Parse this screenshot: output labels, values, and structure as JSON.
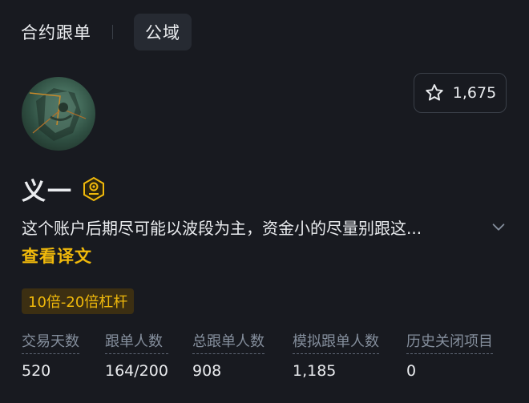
{
  "nav": {
    "title": "合约跟单",
    "pill": "公域"
  },
  "profile": {
    "name": "义一",
    "follow_count": "1,675",
    "bio": "这个账户后期尽可能以波段为主，资金小的尽量别跟这...",
    "translate_link": "查看译文",
    "leverage_tag": "10倍-20倍杠杆"
  },
  "stats": [
    {
      "label": "交易天数",
      "value": "520"
    },
    {
      "label": "跟单人数",
      "value": "164/200"
    },
    {
      "label": "总跟单人数",
      "value": "908"
    },
    {
      "label": "模拟跟单人数",
      "value": "1,185"
    },
    {
      "label": "历史关闭项目",
      "value": "0"
    }
  ],
  "colors": {
    "background": "#181a20",
    "accent": "#f0b90b",
    "muted": "#848e9c",
    "text": "#eaecef"
  },
  "icons": {
    "follow": "star-icon",
    "badge": "lead-trader-badge-icon",
    "expand": "chevron-down-icon"
  }
}
